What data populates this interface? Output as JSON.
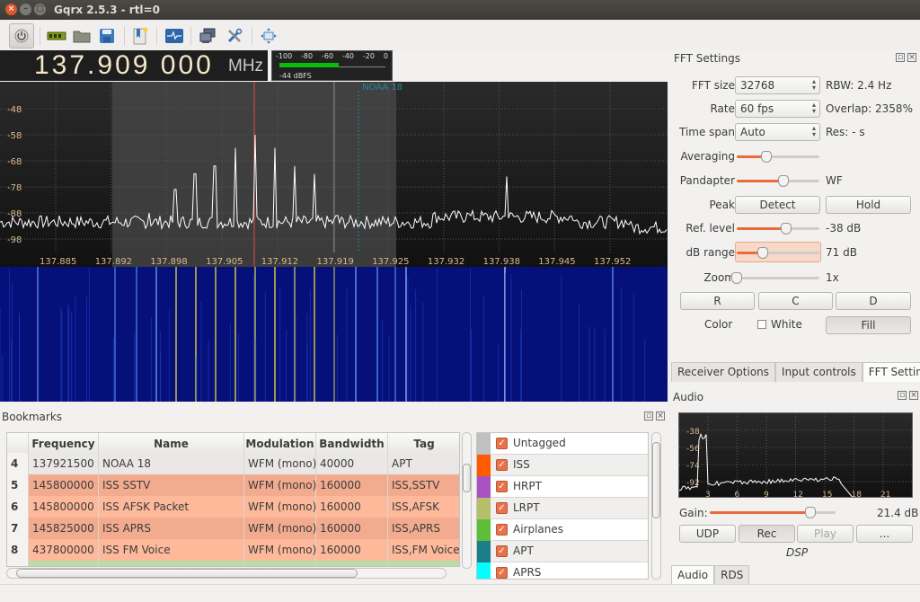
{
  "window": {
    "title": "Gqrx 2.5.3 - rtl=0"
  },
  "toolbar": {
    "icons": [
      "power-icon",
      "hardware-icon",
      "open-folder-icon",
      "save-icon",
      "bookmark-icon",
      "display-icon",
      "network-remote-icon",
      "tools-icon",
      "fullscreen-icon"
    ]
  },
  "frequency": {
    "value": "137.909 000",
    "unit": "MHz"
  },
  "signal_meter": {
    "scale": [
      "-100",
      "-80",
      "-60",
      "-40",
      "-20",
      "0"
    ],
    "level_dbfs": -44,
    "label": "-44 dBFS",
    "fill_fraction": 0.56
  },
  "plotter": {
    "y_ticks": [
      "-48",
      "-58",
      "-68",
      "-78",
      "-88",
      "-98"
    ],
    "x_ticks": [
      "137.885",
      "137.892",
      "137.898",
      "137.905",
      "137.912",
      "137.919",
      "137.925",
      "137.932",
      "137.938",
      "137.945",
      "137.952"
    ],
    "bookmark_label": "NOAA 18",
    "colors": {
      "demod_line": "#e04848",
      "bookmark": "#1d8a9a",
      "trace": "#ffffff",
      "tick_text": "#d9b98f"
    }
  },
  "fft_settings": {
    "title": "FFT Settings",
    "fft_size": {
      "label": "FFT size",
      "value": "32768",
      "side": "RBW: 2.4 Hz"
    },
    "rate": {
      "label": "Rate",
      "value": "60 fps",
      "side": "Overlap: 2358%"
    },
    "time_span": {
      "label": "Time span",
      "value": "Auto",
      "side": "Res: - s"
    },
    "averaging": {
      "label": "Averaging",
      "fraction": 0.36
    },
    "pandapter": {
      "label": "Pandapter",
      "fraction": 0.56,
      "side": "WF"
    },
    "peak": {
      "label": "Peak",
      "detect": "Detect",
      "hold": "Hold"
    },
    "ref_level": {
      "label": "Ref. level",
      "fraction": 0.6,
      "side": "-38 dB"
    },
    "db_range": {
      "label": "dB range",
      "fraction": 0.32,
      "side": "71 dB"
    },
    "zoom": {
      "label": "Zoom",
      "fraction": 0.0,
      "side": "1x"
    },
    "buttons": {
      "r": "R",
      "c": "C",
      "d": "D"
    },
    "color": {
      "label": "Color",
      "white_label": "White",
      "white_checked": false,
      "fill": "Fill"
    }
  },
  "right_tabs": [
    "Receiver Options",
    "Input controls",
    "FFT Settings"
  ],
  "audio": {
    "title": "Audio",
    "y_ticks": [
      "-38",
      "-56",
      "-74",
      "-92"
    ],
    "x_ticks": [
      "3",
      "6",
      "9",
      "12",
      "15",
      "18",
      "21"
    ],
    "gain_label": "Gain:",
    "gain_fraction": 0.8,
    "gain_value": "21.4 dB",
    "buttons": {
      "udp": "UDP",
      "rec": "Rec",
      "play": "Play",
      "more": "..."
    },
    "dsp_label": "DSP",
    "tabs": [
      "Audio",
      "RDS"
    ]
  },
  "bookmarks": {
    "title": "Bookmarks",
    "columns": [
      "Frequency",
      "Name",
      "Modulation",
      "Bandwidth",
      "Tag"
    ],
    "rows": [
      {
        "index": "4",
        "frequency": "137921500",
        "name": "NOAA 18",
        "modulation": "WFM (mono)",
        "bandwidth": "40000",
        "tag": "APT",
        "color": "#e9e8e6"
      },
      {
        "index": "5",
        "frequency": "145800000",
        "name": "ISS SSTV",
        "modulation": "WFM (mono)",
        "bandwidth": "160000",
        "tag": "ISS,SSTV",
        "color": "#f2ab8e"
      },
      {
        "index": "6",
        "frequency": "145800000",
        "name": "ISS AFSK Packet",
        "modulation": "WFM (mono)",
        "bandwidth": "160000",
        "tag": "ISS,AFSK",
        "color": "#fdb99a"
      },
      {
        "index": "7",
        "frequency": "145825000",
        "name": "ISS APRS",
        "modulation": "WFM (mono)",
        "bandwidth": "160000",
        "tag": "ISS,APRS",
        "color": "#f2ab8e"
      },
      {
        "index": "8",
        "frequency": "437800000",
        "name": "ISS FM Voice",
        "modulation": "WFM (mono)",
        "bandwidth": "160000",
        "tag": "ISS,FM Voice",
        "color": "#fdb99a"
      },
      {
        "index": "",
        "frequency": "",
        "name": "",
        "modulation": "",
        "bandwidth": "",
        "tag": "",
        "color": "#b9dca8"
      }
    ],
    "tags": [
      {
        "name": "Untagged",
        "color": "#c0c0c0",
        "checked": true
      },
      {
        "name": "ISS",
        "color": "#ff5a00",
        "checked": true
      },
      {
        "name": "HRPT",
        "color": "#a852c2",
        "checked": true
      },
      {
        "name": "LRPT",
        "color": "#b6be6a",
        "checked": true
      },
      {
        "name": "Airplanes",
        "color": "#5dbf38",
        "checked": true
      },
      {
        "name": "APT",
        "color": "#1a7f8a",
        "checked": true
      },
      {
        "name": "APRS",
        "color": "#00ffff",
        "checked": true
      }
    ]
  }
}
